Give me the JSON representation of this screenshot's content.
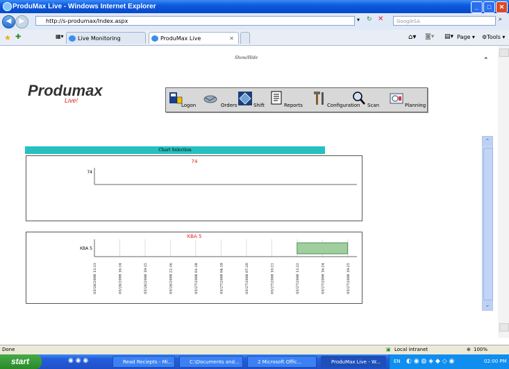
{
  "window": {
    "title": "ProduMax Live - Windows Internet Explorer"
  },
  "address": {
    "url": "http://s-produmax/Index.aspx",
    "search_placeholder": "GoogleSA"
  },
  "tabs": [
    {
      "label": "Live Monitoring"
    },
    {
      "label": "ProduMax Live"
    }
  ],
  "toolbar_right": {
    "page": "Page",
    "tools": "Tools"
  },
  "page": {
    "showhide": "Show/Hide",
    "logo": "Produmax",
    "logo_sub": "Live!",
    "nav": [
      {
        "label": "Logon",
        "icon": "logon-icon"
      },
      {
        "label": "Orders",
        "icon": "handshake-icon"
      },
      {
        "label": "Shift",
        "icon": "shift-icon"
      },
      {
        "label": "Reports",
        "icon": "reports-icon"
      },
      {
        "label": "Configuration",
        "icon": "tools-icon"
      },
      {
        "label": "Scan",
        "icon": "scan-icon"
      },
      {
        "label": "Planning",
        "icon": "planning-icon"
      }
    ],
    "chart_selection": "Chart Selection"
  },
  "chart_data": [
    {
      "type": "bar",
      "title": "74",
      "categories": [
        "74"
      ],
      "series": [],
      "xlabel": "",
      "ylabel": ""
    },
    {
      "type": "bar",
      "title": "KBA 5",
      "categories": [
        "KBA 5"
      ],
      "x_ticks": [
        "05/26/2008 13:13",
        "05/26/2008 16:14",
        "05/26/2008 19:15",
        "05/26/2008 22:16",
        "05/27/2008 01:18",
        "05/27/2008 04:19",
        "05/27/2008 07:20",
        "05/27/2008 10:21",
        "05/27/2008 13:22",
        "05/27/2008 16:24",
        "05/27/2008 19:25"
      ],
      "segments": [
        {
          "category": "KBA 5",
          "start": "05/27/2008 13:22",
          "end": "05/27/2008 19:25"
        }
      ],
      "colors": {
        "bar": "#9fce9f",
        "bar_border": "#3a7a3a",
        "title": "#e02020"
      }
    }
  ],
  "status": {
    "left": "Done",
    "zone": "Local intranet",
    "zoom": "100%"
  },
  "taskbar": {
    "start": "start",
    "tasks": [
      "Read Reciepts - Mi...",
      "C:\\Documents and...",
      "2 Microsoft Offic...",
      "ProduMax Live - W..."
    ],
    "lang": "EN",
    "clock": "02:00 PM"
  }
}
